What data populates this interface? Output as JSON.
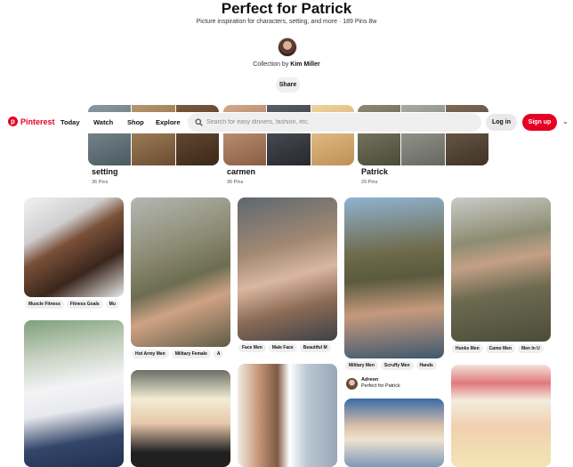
{
  "board": {
    "title": "Perfect for Patrick",
    "subtitle": "Picture inspiration for characters, setting, and more · 189 Pins 8w",
    "collection_prefix": "Collection by",
    "collection_owner": "Kim Miller",
    "share_label": "Share"
  },
  "nav": {
    "logo_text": "Pinterest",
    "links": [
      "Today",
      "Watch",
      "Shop",
      "Explore"
    ],
    "search_placeholder": "Search for easy dinners, fashion, etc.",
    "login_label": "Log in",
    "signup_label": "Sign up"
  },
  "sections": [
    {
      "name": "setting",
      "count": "36 Pins",
      "colors": [
        "#6d7c83",
        "#9b7a55",
        "#4f3a2a"
      ]
    },
    {
      "name": "carmen",
      "count": "30 Pins",
      "colors": [
        "#b88a6c",
        "#3c3f46",
        "#d7b57c"
      ]
    },
    {
      "name": "Patrick",
      "count": "29 Pins",
      "colors": [
        "#6e6c5a",
        "#8c8d86",
        "#5b4d3c"
      ]
    }
  ],
  "pins": [
    {
      "tags": [
        "Muscle Fitness",
        "Fitness Goals",
        "Mu"
      ],
      "colors": [
        "#3b2b24",
        "#9b6a4e"
      ]
    },
    {
      "tags": [
        "Hot Army Men",
        "Military Female",
        "A"
      ],
      "colors": [
        "#6f6f55",
        "#c9a283"
      ]
    },
    {
      "tags": [
        "Face Men",
        "Male Face",
        "Beautiful M"
      ],
      "colors": [
        "#4d5860",
        "#d6b49e"
      ]
    },
    {
      "tags": [
        "Military Men",
        "Scruffy Men",
        "Hands"
      ],
      "colors": [
        "#4a6377",
        "#5e5a3e"
      ]
    },
    {
      "tags": [
        "Hunks Men",
        "Camo Men",
        "Men In U"
      ],
      "colors": [
        "#5c5e47",
        "#7c8c9a"
      ]
    },
    {
      "pinner_name": "Adreon",
      "pinner_board": "Perfect for Patrick"
    }
  ]
}
